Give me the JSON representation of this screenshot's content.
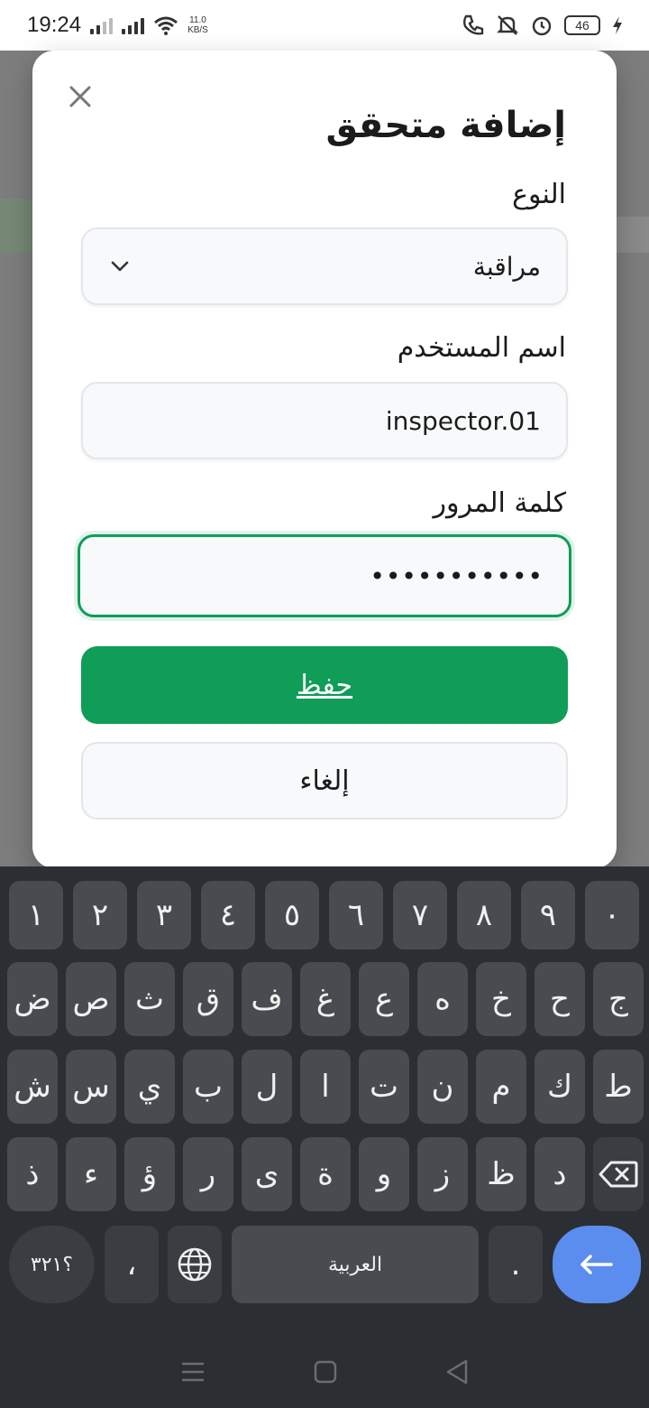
{
  "status_bar": {
    "time": "19:24",
    "net_speed_value": "11.0",
    "net_speed_unit": "KB/S",
    "battery": "46"
  },
  "modal": {
    "title": "إضافة متحقق",
    "type_label": "النوع",
    "type_value": "مراقبة",
    "username_label": "اسم المستخدم",
    "username_value": "inspector.01",
    "password_label": "كلمة المرور",
    "password_value": "•••••••••••",
    "save_label": "حفظ",
    "cancel_label": "إلغاء"
  },
  "keyboard": {
    "row1": [
      "١",
      "٢",
      "٣",
      "٤",
      "٥",
      "٦",
      "٧",
      "٨",
      "٩",
      "٠"
    ],
    "row2": [
      "ض",
      "ص",
      "ث",
      "ق",
      "ف",
      "غ",
      "ع",
      "ه",
      "خ",
      "ح",
      "ج"
    ],
    "row3": [
      "ش",
      "س",
      "ي",
      "ب",
      "ل",
      "ا",
      "ت",
      "ن",
      "م",
      "ك",
      "ط"
    ],
    "row4": [
      "ذ",
      "ء",
      "ؤ",
      "ر",
      "ى",
      "ة",
      "و",
      "ز",
      "ظ",
      "د"
    ],
    "symbols_label": "؟٣٢١",
    "comma_label": "،",
    "space_label": "العربية",
    "period_label": "."
  },
  "colors": {
    "accent": "#0f9d58",
    "enter_key": "#5b8def"
  }
}
